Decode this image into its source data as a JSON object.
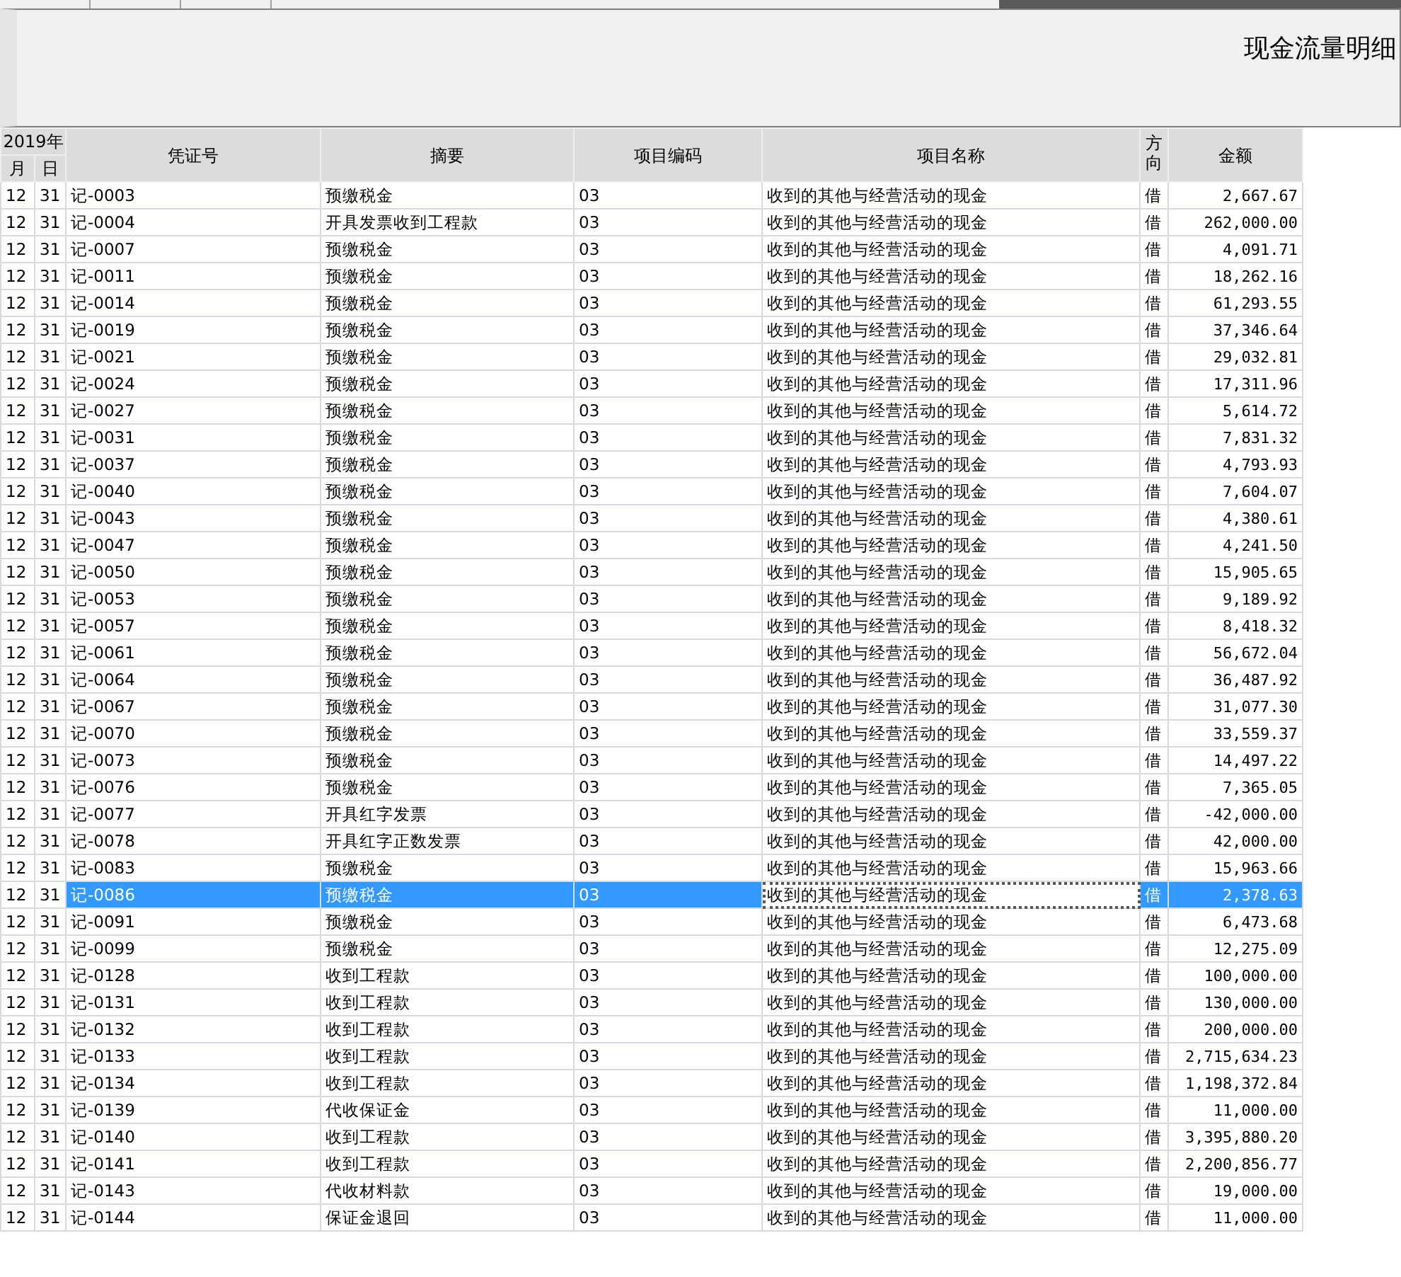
{
  "report": {
    "title": "现金流量明细"
  },
  "table": {
    "year_label": "2019年",
    "month_label": "月",
    "day_label": "日",
    "columns": [
      {
        "label": "凭证号",
        "focused": false
      },
      {
        "label": "摘要",
        "focused": false
      },
      {
        "label": "项目编码",
        "focused": false
      },
      {
        "label": "项目名称",
        "focused": true
      },
      {
        "label": "方向",
        "focused": false
      },
      {
        "label": "金额",
        "focused": false
      }
    ],
    "rows": [
      {
        "month": "12",
        "day": "31",
        "voucher": "记-0003",
        "summary": "预缴税金",
        "code": "03",
        "item": "收到的其他与经营活动的现金",
        "direction": "借",
        "amount": "2,667.67",
        "selected": false
      },
      {
        "month": "12",
        "day": "31",
        "voucher": "记-0004",
        "summary": "开具发票收到工程款",
        "code": "03",
        "item": "收到的其他与经营活动的现金",
        "direction": "借",
        "amount": "262,000.00",
        "selected": false
      },
      {
        "month": "12",
        "day": "31",
        "voucher": "记-0007",
        "summary": "预缴税金",
        "code": "03",
        "item": "收到的其他与经营活动的现金",
        "direction": "借",
        "amount": "4,091.71",
        "selected": false
      },
      {
        "month": "12",
        "day": "31",
        "voucher": "记-0011",
        "summary": "预缴税金",
        "code": "03",
        "item": "收到的其他与经营活动的现金",
        "direction": "借",
        "amount": "18,262.16",
        "selected": false
      },
      {
        "month": "12",
        "day": "31",
        "voucher": "记-0014",
        "summary": "预缴税金",
        "code": "03",
        "item": "收到的其他与经营活动的现金",
        "direction": "借",
        "amount": "61,293.55",
        "selected": false
      },
      {
        "month": "12",
        "day": "31",
        "voucher": "记-0019",
        "summary": "预缴税金",
        "code": "03",
        "item": "收到的其他与经营活动的现金",
        "direction": "借",
        "amount": "37,346.64",
        "selected": false
      },
      {
        "month": "12",
        "day": "31",
        "voucher": "记-0021",
        "summary": "预缴税金",
        "code": "03",
        "item": "收到的其他与经营活动的现金",
        "direction": "借",
        "amount": "29,032.81",
        "selected": false
      },
      {
        "month": "12",
        "day": "31",
        "voucher": "记-0024",
        "summary": "预缴税金",
        "code": "03",
        "item": "收到的其他与经营活动的现金",
        "direction": "借",
        "amount": "17,311.96",
        "selected": false
      },
      {
        "month": "12",
        "day": "31",
        "voucher": "记-0027",
        "summary": "预缴税金",
        "code": "03",
        "item": "收到的其他与经营活动的现金",
        "direction": "借",
        "amount": "5,614.72",
        "selected": false
      },
      {
        "month": "12",
        "day": "31",
        "voucher": "记-0031",
        "summary": "预缴税金",
        "code": "03",
        "item": "收到的其他与经营活动的现金",
        "direction": "借",
        "amount": "7,831.32",
        "selected": false
      },
      {
        "month": "12",
        "day": "31",
        "voucher": "记-0037",
        "summary": "预缴税金",
        "code": "03",
        "item": "收到的其他与经营活动的现金",
        "direction": "借",
        "amount": "4,793.93",
        "selected": false
      },
      {
        "month": "12",
        "day": "31",
        "voucher": "记-0040",
        "summary": "预缴税金",
        "code": "03",
        "item": "收到的其他与经营活动的现金",
        "direction": "借",
        "amount": "7,604.07",
        "selected": false
      },
      {
        "month": "12",
        "day": "31",
        "voucher": "记-0043",
        "summary": "预缴税金",
        "code": "03",
        "item": "收到的其他与经营活动的现金",
        "direction": "借",
        "amount": "4,380.61",
        "selected": false
      },
      {
        "month": "12",
        "day": "31",
        "voucher": "记-0047",
        "summary": "预缴税金",
        "code": "03",
        "item": "收到的其他与经营活动的现金",
        "direction": "借",
        "amount": "4,241.50",
        "selected": false
      },
      {
        "month": "12",
        "day": "31",
        "voucher": "记-0050",
        "summary": "预缴税金",
        "code": "03",
        "item": "收到的其他与经营活动的现金",
        "direction": "借",
        "amount": "15,905.65",
        "selected": false
      },
      {
        "month": "12",
        "day": "31",
        "voucher": "记-0053",
        "summary": "预缴税金",
        "code": "03",
        "item": "收到的其他与经营活动的现金",
        "direction": "借",
        "amount": "9,189.92",
        "selected": false
      },
      {
        "month": "12",
        "day": "31",
        "voucher": "记-0057",
        "summary": "预缴税金",
        "code": "03",
        "item": "收到的其他与经营活动的现金",
        "direction": "借",
        "amount": "8,418.32",
        "selected": false
      },
      {
        "month": "12",
        "day": "31",
        "voucher": "记-0061",
        "summary": "预缴税金",
        "code": "03",
        "item": "收到的其他与经营活动的现金",
        "direction": "借",
        "amount": "56,672.04",
        "selected": false
      },
      {
        "month": "12",
        "day": "31",
        "voucher": "记-0064",
        "summary": "预缴税金",
        "code": "03",
        "item": "收到的其他与经营活动的现金",
        "direction": "借",
        "amount": "36,487.92",
        "selected": false
      },
      {
        "month": "12",
        "day": "31",
        "voucher": "记-0067",
        "summary": "预缴税金",
        "code": "03",
        "item": "收到的其他与经营活动的现金",
        "direction": "借",
        "amount": "31,077.30",
        "selected": false
      },
      {
        "month": "12",
        "day": "31",
        "voucher": "记-0070",
        "summary": "预缴税金",
        "code": "03",
        "item": "收到的其他与经营活动的现金",
        "direction": "借",
        "amount": "33,559.37",
        "selected": false
      },
      {
        "month": "12",
        "day": "31",
        "voucher": "记-0073",
        "summary": "预缴税金",
        "code": "03",
        "item": "收到的其他与经营活动的现金",
        "direction": "借",
        "amount": "14,497.22",
        "selected": false
      },
      {
        "month": "12",
        "day": "31",
        "voucher": "记-0076",
        "summary": "预缴税金",
        "code": "03",
        "item": "收到的其他与经营活动的现金",
        "direction": "借",
        "amount": "7,365.05",
        "selected": false
      },
      {
        "month": "12",
        "day": "31",
        "voucher": "记-0077",
        "summary": "开具红字发票",
        "code": "03",
        "item": "收到的其他与经营活动的现金",
        "direction": "借",
        "amount": "-42,000.00",
        "selected": false
      },
      {
        "month": "12",
        "day": "31",
        "voucher": "记-0078",
        "summary": "开具红字正数发票",
        "code": "03",
        "item": "收到的其他与经营活动的现金",
        "direction": "借",
        "amount": "42,000.00",
        "selected": false
      },
      {
        "month": "12",
        "day": "31",
        "voucher": "记-0083",
        "summary": "预缴税金",
        "code": "03",
        "item": "收到的其他与经营活动的现金",
        "direction": "借",
        "amount": "15,963.66",
        "selected": false
      },
      {
        "month": "12",
        "day": "31",
        "voucher": "记-0086",
        "summary": "预缴税金",
        "code": "03",
        "item": "收到的其他与经营活动的现金",
        "direction": "借",
        "amount": "2,378.63",
        "selected": true
      },
      {
        "month": "12",
        "day": "31",
        "voucher": "记-0091",
        "summary": "预缴税金",
        "code": "03",
        "item": "收到的其他与经营活动的现金",
        "direction": "借",
        "amount": "6,473.68",
        "selected": false
      },
      {
        "month": "12",
        "day": "31",
        "voucher": "记-0099",
        "summary": "预缴税金",
        "code": "03",
        "item": "收到的其他与经营活动的现金",
        "direction": "借",
        "amount": "12,275.09",
        "selected": false
      },
      {
        "month": "12",
        "day": "31",
        "voucher": "记-0128",
        "summary": "收到工程款",
        "code": "03",
        "item": "收到的其他与经营活动的现金",
        "direction": "借",
        "amount": "100,000.00",
        "selected": false
      },
      {
        "month": "12",
        "day": "31",
        "voucher": "记-0131",
        "summary": "收到工程款",
        "code": "03",
        "item": "收到的其他与经营活动的现金",
        "direction": "借",
        "amount": "130,000.00",
        "selected": false
      },
      {
        "month": "12",
        "day": "31",
        "voucher": "记-0132",
        "summary": "收到工程款",
        "code": "03",
        "item": "收到的其他与经营活动的现金",
        "direction": "借",
        "amount": "200,000.00",
        "selected": false
      },
      {
        "month": "12",
        "day": "31",
        "voucher": "记-0133",
        "summary": "收到工程款",
        "code": "03",
        "item": "收到的其他与经营活动的现金",
        "direction": "借",
        "amount": "2,715,634.23",
        "selected": false
      },
      {
        "month": "12",
        "day": "31",
        "voucher": "记-0134",
        "summary": "收到工程款",
        "code": "03",
        "item": "收到的其他与经营活动的现金",
        "direction": "借",
        "amount": "1,198,372.84",
        "selected": false
      },
      {
        "month": "12",
        "day": "31",
        "voucher": "记-0139",
        "summary": "代收保证金",
        "code": "03",
        "item": "收到的其他与经营活动的现金",
        "direction": "借",
        "amount": "11,000.00",
        "selected": false
      },
      {
        "month": "12",
        "day": "31",
        "voucher": "记-0140",
        "summary": "收到工程款",
        "code": "03",
        "item": "收到的其他与经营活动的现金",
        "direction": "借",
        "amount": "3,395,880.20",
        "selected": false
      },
      {
        "month": "12",
        "day": "31",
        "voucher": "记-0141",
        "summary": "收到工程款",
        "code": "03",
        "item": "收到的其他与经营活动的现金",
        "direction": "借",
        "amount": "2,200,856.77",
        "selected": false
      },
      {
        "month": "12",
        "day": "31",
        "voucher": "记-0143",
        "summary": "代收材料款",
        "code": "03",
        "item": "收到的其他与经营活动的现金",
        "direction": "借",
        "amount": "19,000.00",
        "selected": false
      },
      {
        "month": "12",
        "day": "31",
        "voucher": "记-0144",
        "summary": "保证金退回",
        "code": "03",
        "item": "收到的其他与经营活动的现金",
        "direction": "借",
        "amount": "11,000.00",
        "selected": false
      }
    ]
  }
}
